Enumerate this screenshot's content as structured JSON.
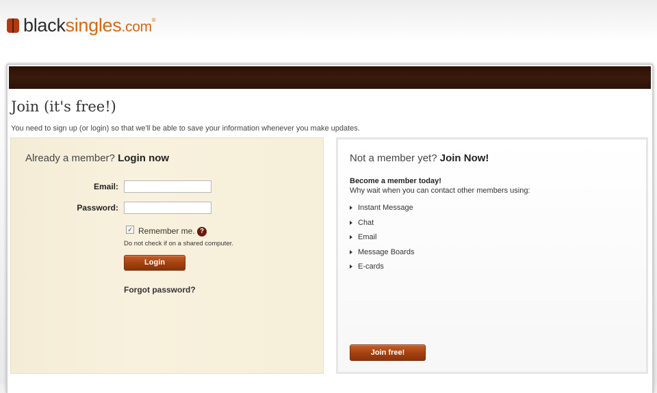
{
  "brand": {
    "black": "black",
    "singles": "singles",
    "dotcom": ".com",
    "reg": "®"
  },
  "page": {
    "title": "Join (it's free!)",
    "subtext": "You need to sign up (or login) so that we'll be able to save your information whenever you make updates."
  },
  "login": {
    "heading_prefix": "Already a member?",
    "heading_strong": "Login now",
    "email_label": "Email:",
    "email_value": "",
    "password_label": "Password:",
    "password_value": "",
    "remember_checked": true,
    "remember_label": "Remember me.",
    "help_glyph": "?",
    "shared_note": "Do not check if on a shared computer.",
    "login_button": "Login",
    "forgot_link": "Forgot password?"
  },
  "join": {
    "heading_prefix": "Not a member yet?",
    "heading_strong": "Join Now!",
    "become": "Become a member today!",
    "whywait": "Why wait when you can contact other members using:",
    "features": [
      "Instant Message",
      "Chat",
      "Email",
      "Message Boards",
      "E-cards"
    ],
    "join_button": "Join free!"
  },
  "colors": {
    "brand_orange": "#d46a12",
    "topbar_brown": "#2b1207",
    "button_brown": "#a2400f",
    "login_panel_bg": "#f6efd9"
  }
}
